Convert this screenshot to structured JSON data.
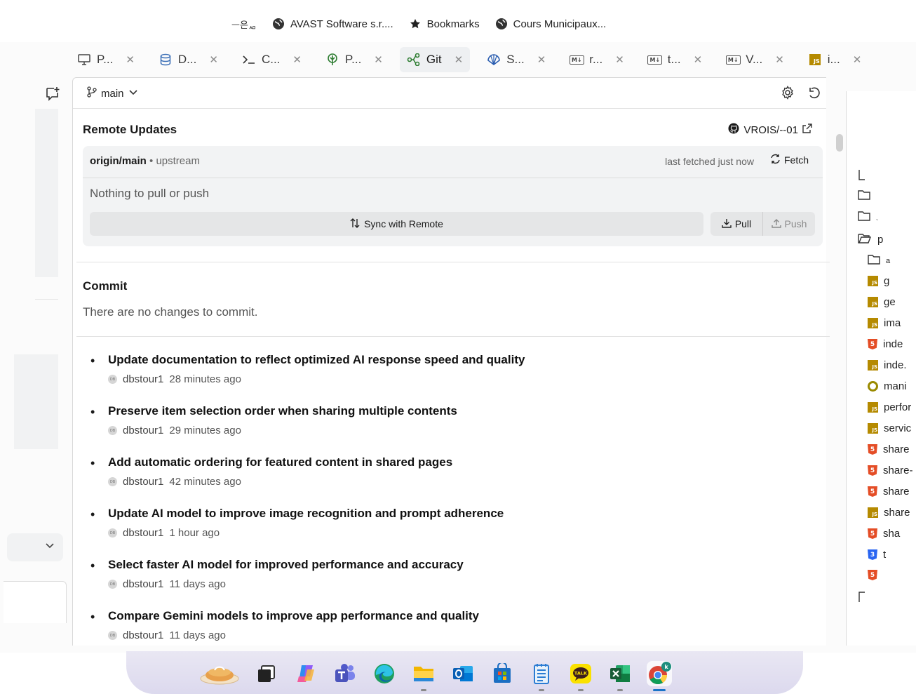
{
  "bookmarks": [
    {
      "label": "ᅳ은ᆺᆷ",
      "icon": "partial-icon"
    },
    {
      "label": "AVAST Software s.r....",
      "icon": "globe-icon"
    },
    {
      "label": "Bookmarks",
      "icon": "star-icon"
    },
    {
      "label": "Cours Municipaux...",
      "icon": "globe-icon"
    }
  ],
  "tabs": [
    {
      "label": "P...",
      "icon": "monitor-icon"
    },
    {
      "label": "D...",
      "icon": "database-icon"
    },
    {
      "label": "C...",
      "icon": "terminal-icon"
    },
    {
      "label": "P...",
      "icon": "tree-icon"
    },
    {
      "label": "Git",
      "icon": "git-icon",
      "active": true
    },
    {
      "label": "S...",
      "icon": "shell-icon"
    },
    {
      "label": "r...",
      "icon": "markdown-icon"
    },
    {
      "label": "t...",
      "icon": "markdown-icon"
    },
    {
      "label": "V...",
      "icon": "markdown-icon"
    },
    {
      "label": "i...",
      "icon": "javascript-icon"
    }
  ],
  "toolbar": {
    "branch": "main"
  },
  "remote": {
    "title": "Remote Updates",
    "repo": "VROIS/--01",
    "branch": "origin/main",
    "upstream": "upstream",
    "fetched": "last fetched just now",
    "fetch_label": "Fetch",
    "status": "Nothing to pull or push",
    "sync_label": "Sync with Remote",
    "pull_label": "Pull",
    "push_label": "Push"
  },
  "commit": {
    "title": "Commit",
    "status": "There are no changes to commit."
  },
  "log": [
    {
      "message": "Update documentation to reflect optimized AI response speed and quality",
      "author": "dbstour1",
      "time": "28 minutes ago"
    },
    {
      "message": "Preserve item selection order when sharing multiple contents",
      "author": "dbstour1",
      "time": "29 minutes ago"
    },
    {
      "message": "Add automatic ordering for featured content in shared pages",
      "author": "dbstour1",
      "time": "42 minutes ago"
    },
    {
      "message": "Update AI model to improve image recognition and prompt adherence",
      "author": "dbstour1",
      "time": "1 hour ago"
    },
    {
      "message": "Select faster AI model for improved performance and accuracy",
      "author": "dbstour1",
      "time": "11 days ago"
    },
    {
      "message": "Compare Gemini models to improve app performance and quality",
      "author": "dbstour1",
      "time": "11 days ago"
    }
  ],
  "avatar_text": "DB",
  "tree": [
    {
      "label": "",
      "icon": "corner-icon"
    },
    {
      "label": "",
      "icon": "folder-icon"
    },
    {
      "label": "ˎ",
      "icon": "folder-icon"
    },
    {
      "label": "p",
      "icon": "folder-open-icon"
    },
    {
      "label": "a",
      "icon": "folder-icon"
    },
    {
      "label": "g",
      "icon": "javascript-icon"
    },
    {
      "label": "ge",
      "icon": "javascript-icon"
    },
    {
      "label": "ima",
      "icon": "javascript-icon"
    },
    {
      "label": "inde",
      "icon": "html-icon"
    },
    {
      "label": "inde.",
      "icon": "javascript-icon"
    },
    {
      "label": "mani",
      "icon": "manifest-icon"
    },
    {
      "label": "perfor",
      "icon": "javascript-icon"
    },
    {
      "label": "servic",
      "icon": "javascript-icon"
    },
    {
      "label": "share",
      "icon": "html-icon"
    },
    {
      "label": "share-",
      "icon": "html-icon"
    },
    {
      "label": "share",
      "icon": "html-icon"
    },
    {
      "label": "share",
      "icon": "javascript-icon"
    },
    {
      "label": "sha",
      "icon": "html-icon"
    },
    {
      "label": "t",
      "icon": "css-icon"
    },
    {
      "label": "",
      "icon": "html-icon"
    },
    {
      "label": "",
      "icon": "corner-icon"
    }
  ],
  "taskbar": [
    {
      "name": "pie-app-icon"
    },
    {
      "name": "task-view-icon"
    },
    {
      "name": "copilot-icon"
    },
    {
      "name": "teams-icon"
    },
    {
      "name": "edge-icon"
    },
    {
      "name": "file-explorer-icon"
    },
    {
      "name": "outlook-icon"
    },
    {
      "name": "store-icon"
    },
    {
      "name": "notepad-icon"
    },
    {
      "name": "kakaotalk-icon"
    },
    {
      "name": "excel-icon"
    },
    {
      "name": "chrome-icon"
    }
  ],
  "kakao_label": "TALK",
  "chrome_badge": "k",
  "colors": {
    "accent": "#1a73c8",
    "git_green": "#2e7d32",
    "js": "#b58a00",
    "html": "#e44d26",
    "css": "#2965f1"
  }
}
